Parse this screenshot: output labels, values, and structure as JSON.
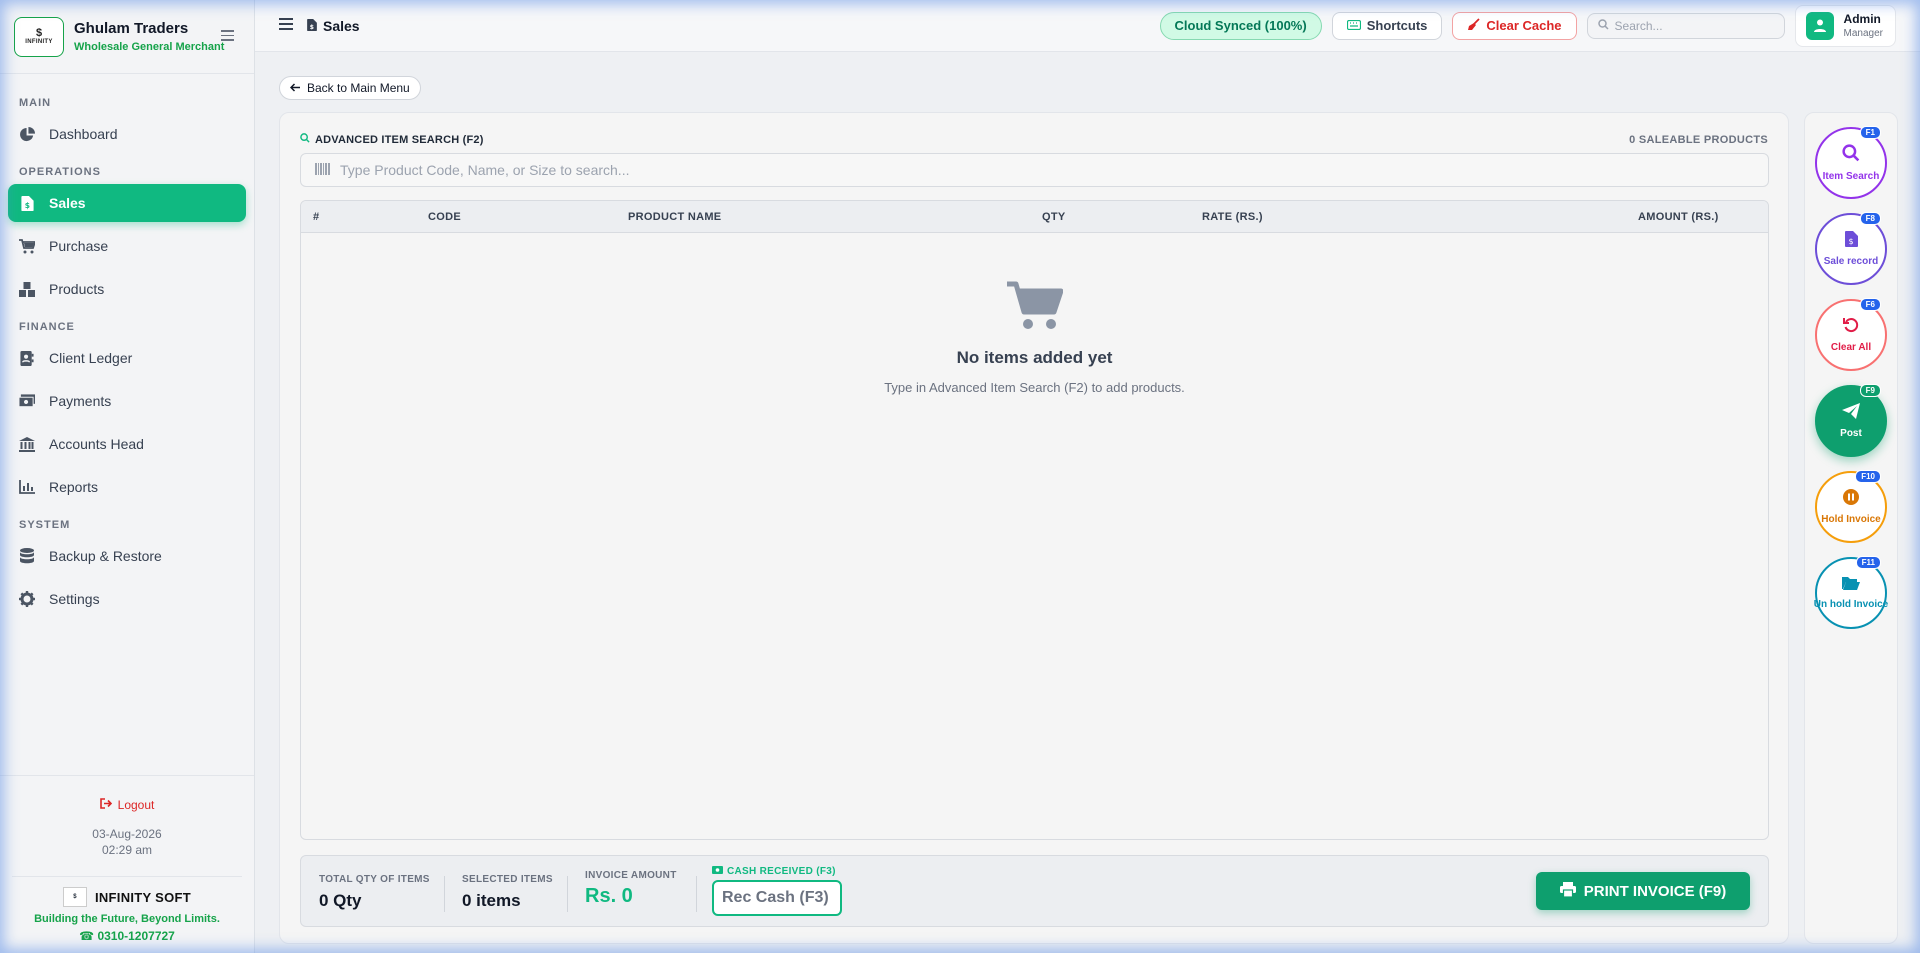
{
  "brand": {
    "title": "Ghulam Traders",
    "subtitle": "Wholesale General Merchant",
    "logo_symbol": "$",
    "logo_text": "INFINITY"
  },
  "sidebar": {
    "sections": [
      {
        "label": "MAIN",
        "items": [
          {
            "label": "Dashboard",
            "icon": "pie-chart-icon"
          }
        ]
      },
      {
        "label": "OPERATIONS",
        "items": [
          {
            "label": "Sales",
            "icon": "invoice-icon",
            "active": true
          },
          {
            "label": "Purchase",
            "icon": "cart-icon"
          },
          {
            "label": "Products",
            "icon": "boxes-icon"
          }
        ]
      },
      {
        "label": "FINANCE",
        "items": [
          {
            "label": "Client Ledger",
            "icon": "contact-book-icon"
          },
          {
            "label": "Payments",
            "icon": "money-icon"
          },
          {
            "label": "Accounts Head",
            "icon": "bank-icon"
          },
          {
            "label": "Reports",
            "icon": "bar-chart-icon"
          }
        ]
      },
      {
        "label": "SYSTEM",
        "items": [
          {
            "label": "Backup & Restore",
            "icon": "database-icon"
          },
          {
            "label": "Settings",
            "icon": "gear-icon"
          }
        ]
      }
    ],
    "logout": "Logout",
    "date": "03-Aug-2026",
    "time": "02:29 am",
    "company": {
      "name": "INFINITY SOFT",
      "tagline": "Building the Future, Beyond Limits.",
      "phone": "0310-1207727"
    }
  },
  "topbar": {
    "title": "Sales",
    "synced": "Cloud Synced (100%)",
    "shortcuts": "Shortcuts",
    "clear_cache": "Clear Cache",
    "search_placeholder": "Search...",
    "user_name": "Admin",
    "user_role": "Manager"
  },
  "main": {
    "back": "Back to Main Menu",
    "adv_title": "ADVANCED ITEM SEARCH (F2)",
    "saleable": "0 SALEABLE PRODUCTS",
    "search_placeholder": "Type Product Code, Name, or Size to search...",
    "columns": [
      "#",
      "CODE",
      "PRODUCT NAME",
      "QTY",
      "RATE (RS.)",
      "AMOUNT (RS.)"
    ],
    "empty_title": "No items added yet",
    "empty_sub": "Type in Advanced Item Search (F2) to add products."
  },
  "summary": {
    "total_qty_label": "TOTAL QTY OF ITEMS",
    "total_qty": "0 Qty",
    "selected_label": "SELECTED ITEMS",
    "selected": "0 items",
    "invoice_label": "INVOICE AMOUNT",
    "invoice": "Rs. 0",
    "cash_label": "CASH RECEIVED (F3)",
    "cash_placeholder": "Rec Cash (F3)",
    "print": "PRINT INVOICE (F9)"
  },
  "actions": [
    {
      "label": "Item Search",
      "key": "F1",
      "color": "#9333ea",
      "icon": "search-icon"
    },
    {
      "label": "Sale record",
      "key": "F8",
      "color": "#6d4ed8",
      "icon": "invoice-icon"
    },
    {
      "label": "Clear All",
      "key": "F6",
      "color": "#e11d48",
      "icon": "undo-icon"
    },
    {
      "label": "Post",
      "key": "F9",
      "color": "#ffffff",
      "icon": "send-icon"
    },
    {
      "label": "Hold Invoice",
      "key": "F10",
      "color": "#d97706",
      "icon": "pause-icon"
    },
    {
      "label": "Un hold Invoice",
      "key": "F11",
      "color": "#0891b2",
      "icon": "folder-open-icon"
    }
  ]
}
